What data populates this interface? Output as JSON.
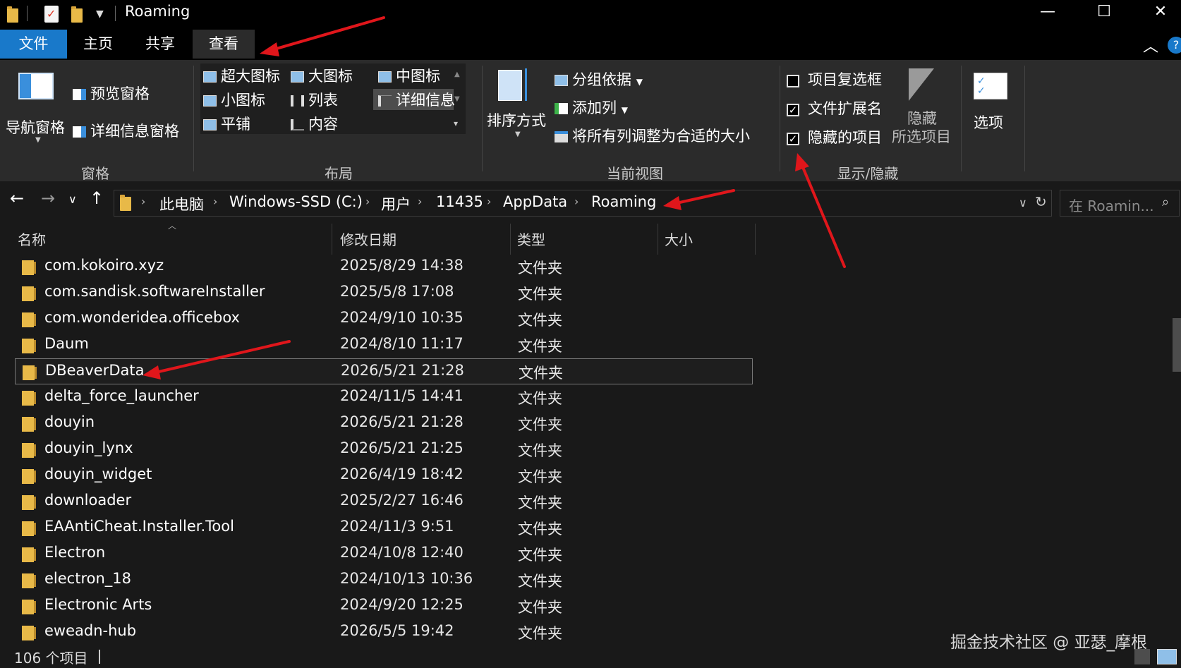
{
  "window": {
    "title": "Roaming",
    "minimize_glyph": "—",
    "maximize_glyph": "☐",
    "close_glyph": "✕"
  },
  "tabs": [
    {
      "label": "文件"
    },
    {
      "label": "主页"
    },
    {
      "label": "共享"
    },
    {
      "label": "查看"
    }
  ],
  "ribbon": {
    "panes": {
      "nav_pane": "导航窗格",
      "preview_pane": "预览窗格",
      "details_pane": "详细信息窗格",
      "group_label": "窗格"
    },
    "layout": {
      "items": [
        "超大图标",
        "大图标",
        "中图标",
        "小图标",
        "列表",
        "详细信息",
        "平铺",
        "内容"
      ],
      "selected": "详细信息",
      "group_label": "布局"
    },
    "current_view": {
      "sort_by": "排序方式",
      "group_by": "分组依据",
      "add_columns": "添加列",
      "fit_columns": "将所有列调整为合适的大小",
      "group_label": "当前视图"
    },
    "show_hide": {
      "item_checkboxes": {
        "label": "项目复选框",
        "checked": false
      },
      "file_extensions": {
        "label": "文件扩展名",
        "checked": true
      },
      "hidden_items": {
        "label": "隐藏的项目",
        "checked": true
      },
      "hide_selected_line1": "隐藏",
      "hide_selected_line2": "所选项目",
      "group_label": "显示/隐藏"
    },
    "options": "选项"
  },
  "address": {
    "crumbs": [
      "此电脑",
      "Windows-SSD (C:)",
      "用户",
      "11435",
      "AppData",
      "Roaming"
    ],
    "search_placeholder": "在 Roamin..."
  },
  "columns": {
    "name": "名称",
    "date": "修改日期",
    "type": "类型",
    "size": "大小"
  },
  "files": [
    {
      "name": "com.kokoiro.xyz",
      "date": "2025/8/29 14:38",
      "type": "文件夹"
    },
    {
      "name": "com.sandisk.softwareInstaller",
      "date": "2025/5/8 17:08",
      "type": "文件夹"
    },
    {
      "name": "com.wonderidea.officebox",
      "date": "2024/9/10 10:35",
      "type": "文件夹"
    },
    {
      "name": "Daum",
      "date": "2024/8/10 11:17",
      "type": "文件夹"
    },
    {
      "name": "DBeaverData",
      "date": "2026/5/21 21:28",
      "type": "文件夹",
      "selected": true
    },
    {
      "name": "delta_force_launcher",
      "date": "2024/11/5 14:41",
      "type": "文件夹"
    },
    {
      "name": "douyin",
      "date": "2026/5/21 21:28",
      "type": "文件夹"
    },
    {
      "name": "douyin_lynx",
      "date": "2026/5/21 21:25",
      "type": "文件夹"
    },
    {
      "name": "douyin_widget",
      "date": "2026/4/19 18:42",
      "type": "文件夹"
    },
    {
      "name": "downloader",
      "date": "2025/2/27 16:46",
      "type": "文件夹"
    },
    {
      "name": "EAAntiCheat.Installer.Tool",
      "date": "2024/11/3 9:51",
      "type": "文件夹"
    },
    {
      "name": "Electron",
      "date": "2024/10/8 12:40",
      "type": "文件夹"
    },
    {
      "name": "electron_18",
      "date": "2024/10/13 10:36",
      "type": "文件夹"
    },
    {
      "name": "Electronic Arts",
      "date": "2024/9/20 12:25",
      "type": "文件夹"
    },
    {
      "name": "eweadn-hub",
      "date": "2026/5/5 19:42",
      "type": "文件夹"
    }
  ],
  "status": {
    "item_count": "106 个项目"
  },
  "watermark": "掘金技术社区 @ 亚瑟_摩根",
  "colors": {
    "accent": "#1979ca",
    "folder": "#e8b948",
    "annotation_arrow": "#e0161b"
  }
}
